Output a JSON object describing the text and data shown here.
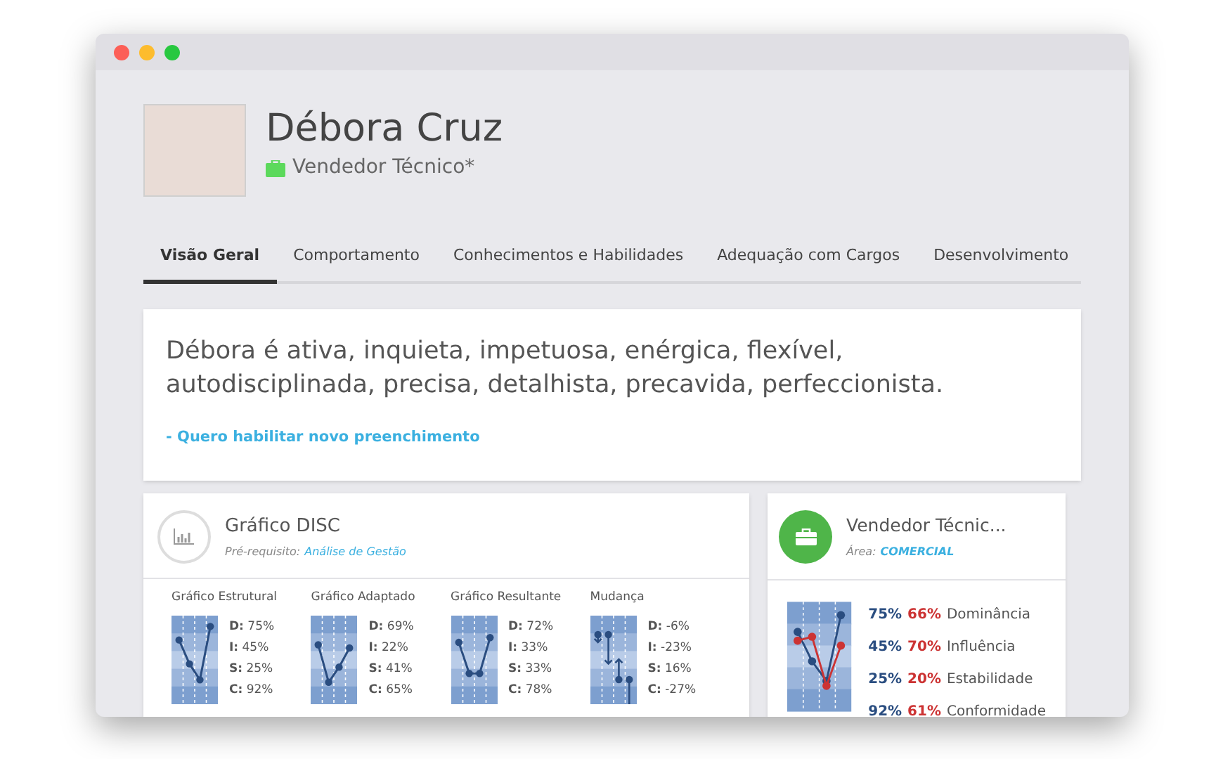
{
  "profile": {
    "name": "Débora Cruz",
    "role": "Vendedor Técnico*"
  },
  "tabs": [
    {
      "label": "Visão Geral",
      "selected": true
    },
    {
      "label": "Comportamento",
      "selected": false
    },
    {
      "label": "Conhecimentos e Habilidades",
      "selected": false
    },
    {
      "label": "Adequação com Cargos",
      "selected": false
    },
    {
      "label": "Desenvolvimento",
      "selected": false
    }
  ],
  "summary": {
    "text": "Débora é ativa, inquieta, impetuosa, enérgica, flexível, autodisciplinada, precisa, detalhista, precavida, perfeccionista.",
    "link": "- Quero habilitar novo preenchimento"
  },
  "disc": {
    "title": "Gráfico DISC",
    "prereq_label": "Pré-requisito:",
    "prereq_link": "Análise de Gestão",
    "charts": [
      {
        "kind": "profile",
        "title": "Gráfico Estrutural",
        "rows": [
          [
            "D:",
            "75%"
          ],
          [
            "I:",
            "45%"
          ],
          [
            "S:",
            "25%"
          ],
          [
            "C:",
            "92%"
          ]
        ]
      },
      {
        "kind": "profile",
        "title": "Gráfico Adaptado",
        "rows": [
          [
            "D:",
            "69%"
          ],
          [
            "I:",
            "22%"
          ],
          [
            "S:",
            "41%"
          ],
          [
            "C:",
            "65%"
          ]
        ]
      },
      {
        "kind": "profile",
        "title": "Gráfico Resultante",
        "rows": [
          [
            "D:",
            "72%"
          ],
          [
            "I:",
            "33%"
          ],
          [
            "S:",
            "33%"
          ],
          [
            "C:",
            "78%"
          ]
        ]
      },
      {
        "kind": "change",
        "title": "Mudança",
        "rows": [
          [
            "D:",
            "-6%"
          ],
          [
            "I:",
            "-23%"
          ],
          [
            "S:",
            "16%"
          ],
          [
            "C:",
            "-27%"
          ]
        ]
      }
    ]
  },
  "job": {
    "title": "Vendedor Técnic...",
    "area_label": "Área:",
    "area": "COMERCIAL",
    "rows": [
      {
        "a": "75%",
        "b": "66%",
        "label": "Dominância"
      },
      {
        "a": "45%",
        "b": "70%",
        "label": "Influência"
      },
      {
        "a": "25%",
        "b": "20%",
        "label": "Estabilidade"
      },
      {
        "a": "92%",
        "b": "61%",
        "label": "Conformidade"
      }
    ]
  }
}
